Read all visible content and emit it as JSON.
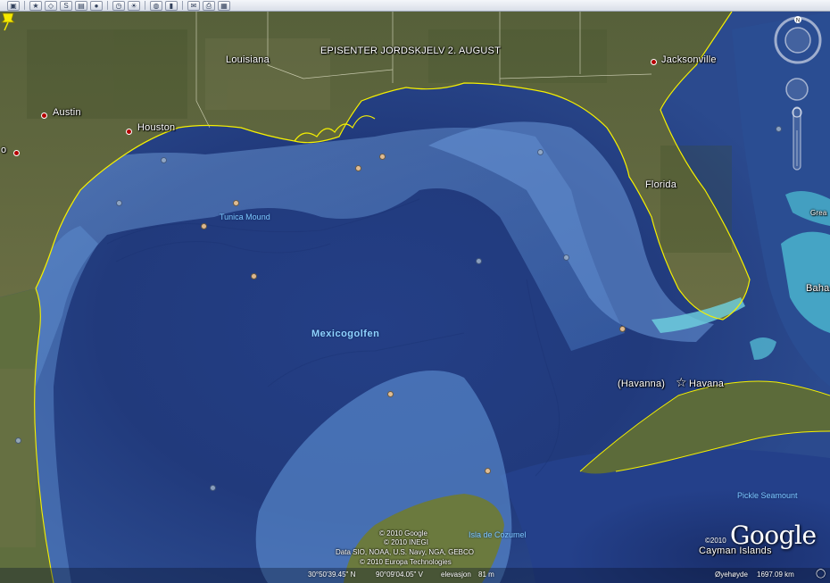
{
  "toolbar": {
    "buttons": [
      "sidebar",
      "placemark",
      "polygon",
      "path",
      "overlay",
      "tour",
      "sun",
      "planets",
      "ruler",
      "email",
      "print",
      "view-in-maps"
    ]
  },
  "map": {
    "places": {
      "louisiana": "Louisiana",
      "austin": "Austin",
      "houston": "Houston",
      "jacksonville": "Jacksonville",
      "florida": "Florida",
      "havana_paren": "(Havanna)",
      "havana": "Havana",
      "edge_left": "o",
      "bahamas_partial": "Baha",
      "great_partial": "Grea"
    },
    "water": {
      "gulf": "Mexicogolfen",
      "tunica_mound": "Tunica Mound",
      "isla_cozumel": "Isla de Cozumel",
      "pickle_seamount": "Pickle Seamount",
      "cayman_islands": "Cayman Islands"
    },
    "placemark_label": "EPISENTER JORDSKJELV 2. AUGUST"
  },
  "attribution": {
    "line1": "© 2010 Google",
    "line2": "© 2010 INEGI",
    "line3": "Data SIO, NOAA, U.S. Navy, NGA, GEBCO",
    "line4": "© 2010 Europa Technologies"
  },
  "logo": {
    "text": "Google",
    "year": "©2010"
  },
  "status": {
    "lat": "30°50'39.45\" N",
    "lon": "90°09'04.05\" V",
    "elevation_label": "elevasjon",
    "elevation": "81 m",
    "eye_alt_label": "Øyehøyde",
    "eye_alt": "1697.09 km"
  },
  "colors": {
    "ocean_deep": "#1f3c80",
    "ocean_shelf": "#4f7fc4",
    "land": "#5d6a3a",
    "coastline": "#f5f000",
    "water_label": "#7ec8ff"
  }
}
